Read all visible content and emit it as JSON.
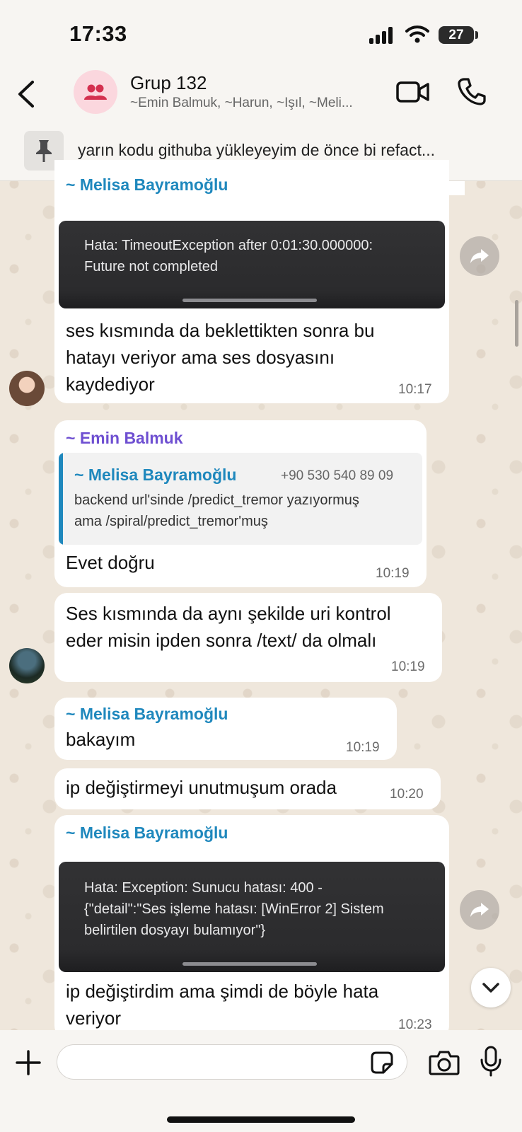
{
  "status_bar": {
    "time": "17:33",
    "battery": "27"
  },
  "header": {
    "title": "Grup 132",
    "members": "~Emin Balmuk, ~Harun, ~Işıl, ~Meli..."
  },
  "pinned": {
    "text": "yarın kodu githuba yükleyeyim de önce bi refact..."
  },
  "messages": [
    {
      "sender": "~ Melisa Bayramoğlu",
      "error": [
        "Hata: TimeoutException after 0:01:30.000000:",
        "Future not completed"
      ],
      "text": [
        "ses kısmında da beklettikten sonra bu",
        "hatayı veriyor ama ses dosyasını",
        "kaydediyor"
      ],
      "time": "10:17"
    },
    {
      "sender": "~ Emin Balmuk",
      "quote_sender": "~ Melisa Bayramoğlu",
      "quote_phone": "+90 530 540 89 09",
      "quote_text": [
        "backend url'sinde /predict_tremor yazıyormuş",
        "ama /spiral/predict_tremor'muş"
      ],
      "text": "Evet doğru",
      "time": "10:19"
    },
    {
      "text": [
        "Ses kısmında da aynı şekilde uri kontrol",
        "eder misin ipden sonra /text/ da olmalı"
      ],
      "time": "10:19"
    },
    {
      "sender": "~ Melisa Bayramoğlu",
      "text": "bakayım",
      "time": "10:19"
    },
    {
      "text": "ip değiştirmeyi unutmuşum orada",
      "time": "10:20"
    },
    {
      "sender": "~ Melisa Bayramoğlu",
      "error": [
        "Hata: Exception: Sunucu hatası: 400 -",
        "{\"detail\":\"Ses işleme hatası: [WinError 2] Sistem",
        "belirtilen dosyayı bulamıyor\"}"
      ],
      "text": [
        "ip değiştirdim ama şimdi de böyle hata",
        "veriyor"
      ],
      "time": "10:23"
    }
  ],
  "composer": {
    "placeholder": ""
  },
  "icons": {
    "back": "chevron-left-icon",
    "group": "people-icon",
    "video": "video-camera-icon",
    "call": "phone-icon",
    "pin": "pin-icon",
    "forward": "forward-arrow-icon",
    "plus": "plus-icon",
    "sticker": "sticker-icon",
    "camera": "camera-icon",
    "mic": "microphone-icon"
  },
  "colors": {
    "melisa": "#1f88bd",
    "emin": "#6e4fd1",
    "bubble": "#ffffff",
    "wallpaper": "#efe7dc"
  }
}
